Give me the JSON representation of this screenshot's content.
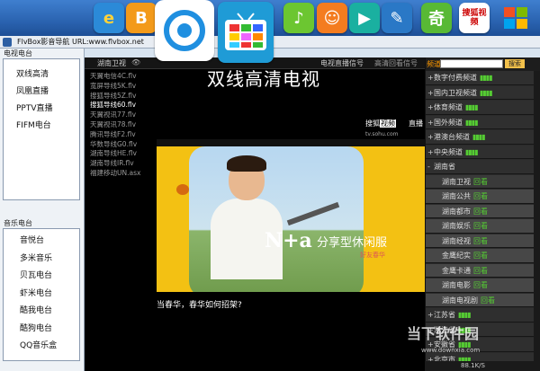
{
  "window": {
    "title": "FlvBox影音导航  URL:www.flvbox.net"
  },
  "dock": {
    "apps": [
      "e",
      "B",
      "P",
      "",
      "♪",
      "☺",
      "▶",
      "✎",
      "奇",
      "搜狐视频",
      "⊞"
    ]
  },
  "left_panel": {
    "tv_group_title": "电视电台",
    "tv_items": [
      "双线高清",
      "凤凰直播",
      "PPTV直播",
      "FIFM电台"
    ],
    "music_group_title": "音乐电台",
    "music_items": [
      "音悦台",
      "多米音乐",
      "贝瓦电台",
      "虾米电台",
      "酷我电台",
      "酷狗电台",
      "QQ音乐盒"
    ]
  },
  "main": {
    "tab_left": "湖南卫视",
    "tab_mid": "电视直播信号",
    "tab_right": "高清回看信号",
    "video_title": "双线高清电视",
    "playlist": [
      "天翼电信4C.flv",
      "宽屏导线5K.flv",
      "搜狐导线5Z.flv",
      "搜狐导线60.flv",
      "天翼视讯77.flv",
      "天翼视讯78.flv",
      "腾讯导线F2.flv",
      "华数导线G0.flv",
      "湖南导线HE.flv",
      "湖南导线IR.flv",
      "福建移动UN.asx"
    ],
    "active_playlist_index": 3,
    "sohu_label": "搜狐",
    "sohu_badge": "视频",
    "sohu_url": "tv.sohu.com",
    "hotline": "直播",
    "ad_brand": "N+a",
    "ad_slogan": "分享型休闲服",
    "ad_sub": "好友春华",
    "subtitle": "当春华，春华如何招架?"
  },
  "right_panel": {
    "label": "频道",
    "search_button": "搜索",
    "channels": [
      {
        "kind": "cat",
        "pm": "+",
        "name": "数字付费频道"
      },
      {
        "kind": "cat",
        "pm": "+",
        "name": "国内卫视频道"
      },
      {
        "kind": "cat",
        "pm": "+",
        "name": "体育频道"
      },
      {
        "kind": "cat",
        "pm": "+",
        "name": "国外频道"
      },
      {
        "kind": "cat",
        "pm": "+",
        "name": "港澳台频道"
      },
      {
        "kind": "cat",
        "pm": "+",
        "name": "中央频道"
      },
      {
        "kind": "cat",
        "pm": "-",
        "name": "湖南省"
      },
      {
        "kind": "sub",
        "name": "湖南卫视",
        "watch": "回看"
      },
      {
        "kind": "sub",
        "name": "湖南公共",
        "watch": "回看"
      },
      {
        "kind": "sub",
        "name": "湖南都市",
        "watch": "回看"
      },
      {
        "kind": "sub",
        "name": "湖南娱乐",
        "watch": "回看"
      },
      {
        "kind": "sub",
        "name": "湖南经视",
        "watch": "回看"
      },
      {
        "kind": "sub",
        "name": "金鹰纪实",
        "watch": "回看"
      },
      {
        "kind": "sub",
        "name": "金鹰卡通",
        "watch": "回看"
      },
      {
        "kind": "sub",
        "name": "湖南电影",
        "watch": "回看"
      },
      {
        "kind": "sub",
        "name": "湖南电视剧",
        "watch": "回看"
      },
      {
        "kind": "cat",
        "pm": "+",
        "name": "江苏省"
      },
      {
        "kind": "cat",
        "pm": "+",
        "name": "浙江省"
      },
      {
        "kind": "cat",
        "pm": "+",
        "name": "安徽省"
      },
      {
        "kind": "cat",
        "pm": "+",
        "name": "北京市"
      }
    ]
  },
  "watermark": {
    "text": "当下软件园",
    "url": "www.downxia.com"
  },
  "status": {
    "speed": "88.1K/S"
  },
  "colors": {
    "accent_green": "#55cc33",
    "panel_dark": "#2b2b2b",
    "ad_yellow": "#f3c113"
  }
}
